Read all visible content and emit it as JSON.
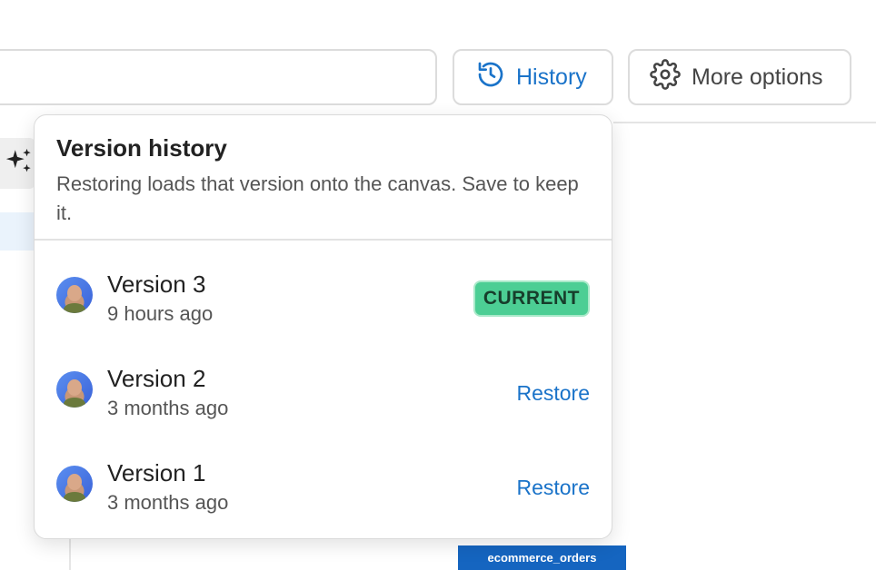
{
  "toolbar": {
    "history_label": "History",
    "more_options_label": "More options"
  },
  "version_history": {
    "title": "Version history",
    "description": "Restoring loads that version onto the canvas. Save to keep it.",
    "versions": [
      {
        "name": "Version 3",
        "time": "9 hours ago",
        "status": "CURRENT"
      },
      {
        "name": "Version 2",
        "time": "3 months ago",
        "action": "Restore"
      },
      {
        "name": "Version 1",
        "time": "3 months ago",
        "action": "Restore"
      }
    ]
  },
  "canvas": {
    "table_tag": "ecommerce_orders"
  },
  "colors": {
    "accent": "#1a73c9",
    "current_badge": "#4cce94",
    "table_tag": "#1565c0"
  },
  "icons": [
    "history-icon",
    "gear-icon",
    "sparkle-icon",
    "avatar"
  ]
}
